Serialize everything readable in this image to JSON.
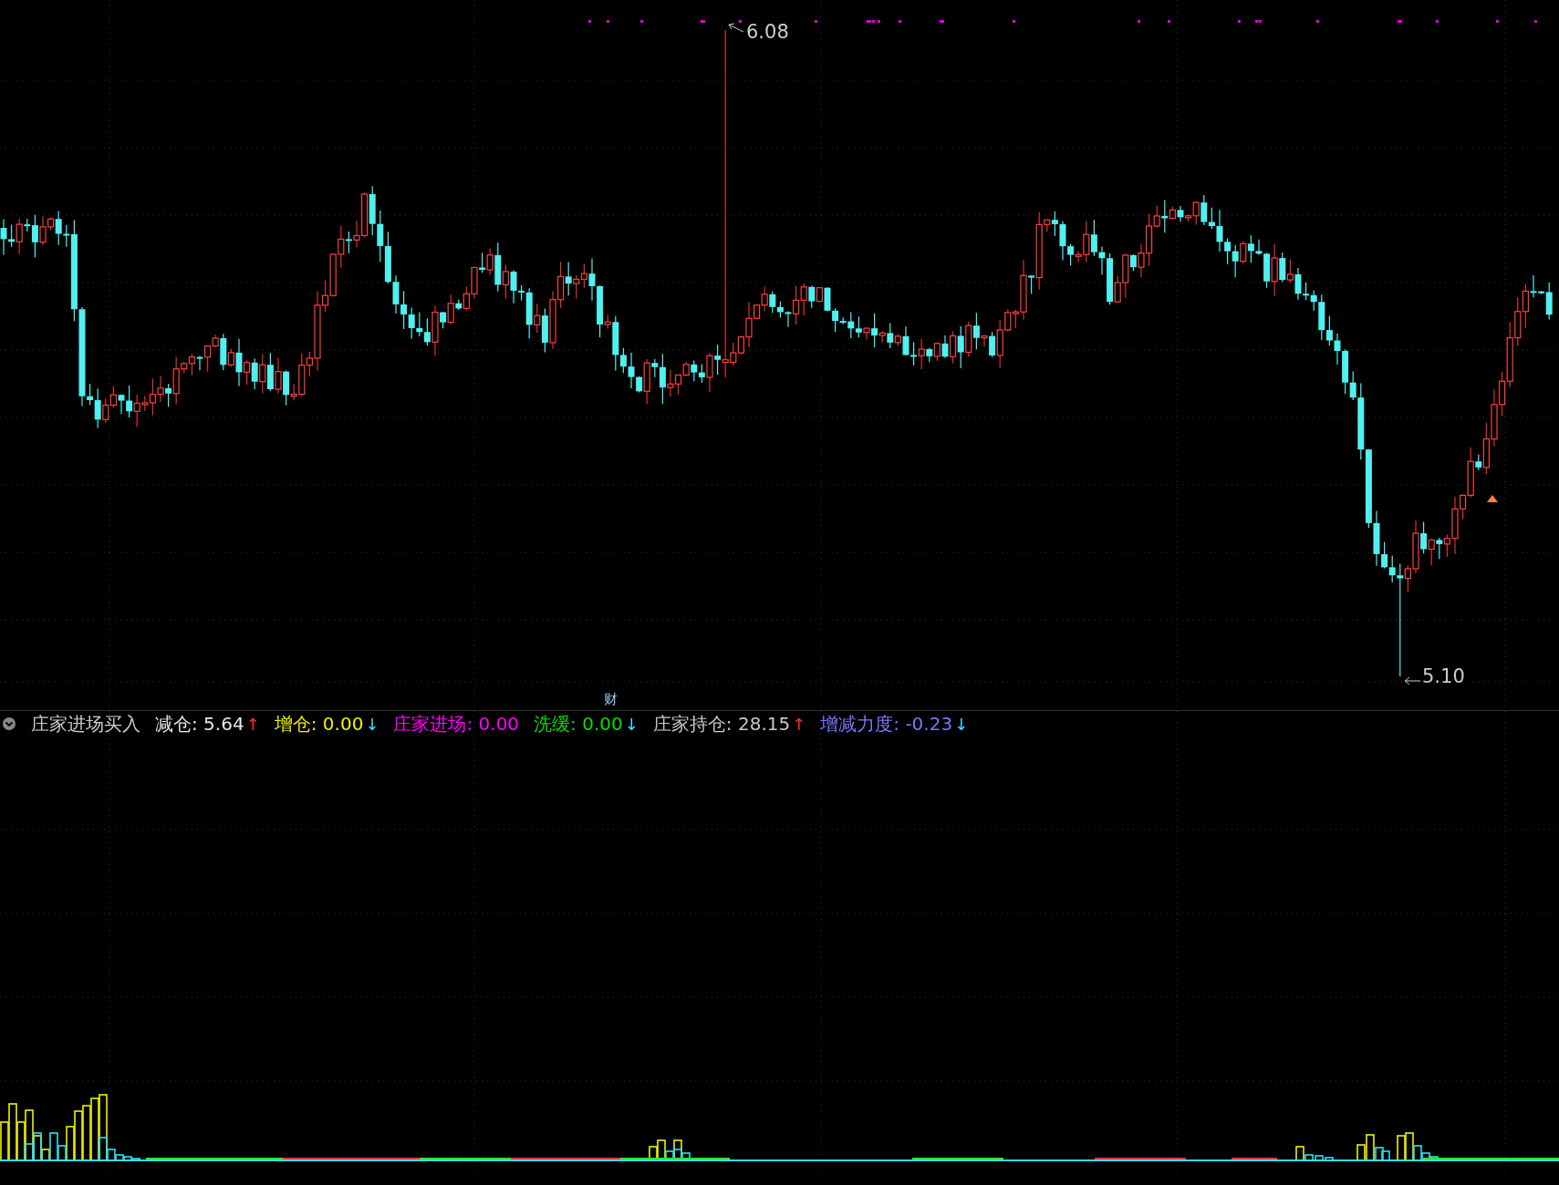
{
  "main_chart": {
    "high_label": "6.08",
    "low_label": "5.10",
    "marker": "财"
  },
  "indicator": {
    "name": "庄家进场买入",
    "items": [
      {
        "label": "减仓:",
        "value": "5.64",
        "arrow": {
          "text": "↑",
          "color": "#ff3030"
        },
        "color": "#e6e6e6"
      },
      {
        "label": "增仓:",
        "value": "0.00",
        "arrow": {
          "text": "↓",
          "color": "#40e0ff"
        },
        "color": "#f0f000"
      },
      {
        "label": "庄家进场:",
        "value": "0.00",
        "color": "#ff00ff"
      },
      {
        "label": "洗缓:",
        "value": "0.00",
        "arrow": {
          "text": "↓",
          "color": "#40e0ff"
        },
        "color": "#00e000"
      },
      {
        "label": "庄家持仓:",
        "value": "28.15",
        "arrow": {
          "text": "↑",
          "color": "#ff3030"
        },
        "color": "#c8c8c8"
      },
      {
        "label": "增减力度:",
        "value": "-0.23",
        "arrow": {
          "text": "↓",
          "color": "#40e0ff"
        },
        "color": "#7878ff"
      }
    ]
  }
}
